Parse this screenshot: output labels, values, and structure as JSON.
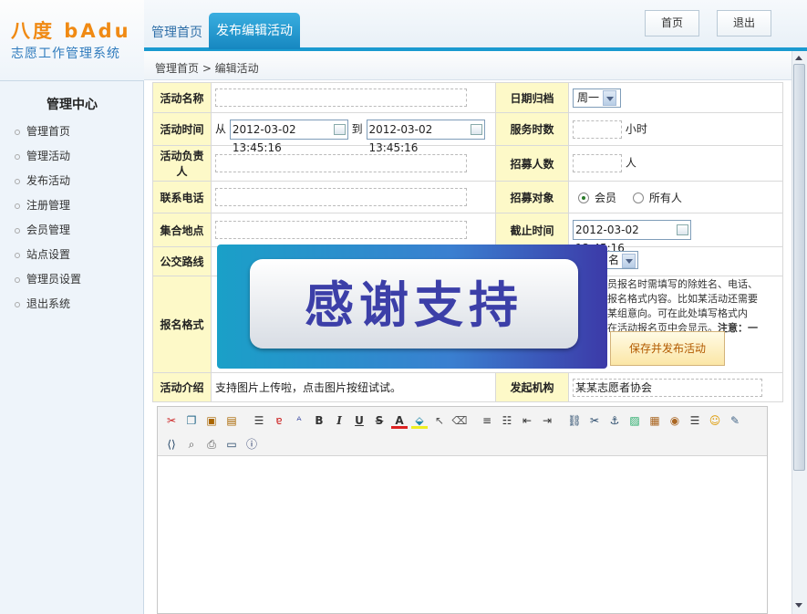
{
  "brand": {
    "title": "八度 bAdu",
    "subtitle": "志愿工作管理系统"
  },
  "nav": {
    "home_tab": "管理首页",
    "active_tab": "发布编辑活动"
  },
  "header_buttons": {
    "home": "首页",
    "exit": "退出"
  },
  "breadcrumb": "管理首页 > 编辑活动",
  "sidebar": {
    "title": "管理中心",
    "items": [
      {
        "label": "管理首页"
      },
      {
        "label": "管理活动"
      },
      {
        "label": "发布活动"
      },
      {
        "label": "注册管理"
      },
      {
        "label": "会员管理"
      },
      {
        "label": "站点设置"
      },
      {
        "label": "管理员设置"
      },
      {
        "label": "退出系统"
      }
    ]
  },
  "form": {
    "activity_name": {
      "label": "活动名称",
      "value": ""
    },
    "date_category": {
      "label": "日期归档",
      "selected": "周一"
    },
    "activity_time": {
      "label": "活动时间",
      "from_text": "从",
      "to_text": "到",
      "start": "2012-03-02 13:45:16",
      "end": "2012-03-02 13:45:16"
    },
    "service_hours": {
      "label": "服务时数",
      "value": "",
      "unit": "小时"
    },
    "leader": {
      "label": "活动负责人",
      "value": ""
    },
    "recruit_count": {
      "label": "招募人数",
      "value": "",
      "unit": "人"
    },
    "phone": {
      "label": "联系电话",
      "value": ""
    },
    "recruit_target": {
      "label": "招募对象",
      "options": [
        "会员",
        "所有人"
      ],
      "selected": "会员"
    },
    "meeting_place": {
      "label": "集合地点",
      "value": ""
    },
    "deadline": {
      "label": "截止时间",
      "value": "2012-03-02 13:45:16"
    },
    "bus_route": {
      "label": "公交路线",
      "select_fragment": "名"
    },
    "signup_format": {
      "label": "报名格式",
      "help_fragment_1": "员报名时需填写的除姓名、电话、",
      "help_fragment_2": "报名格式内容。比如某活动还需要",
      "help_fragment_3": "某组意向。可在此处填写格式内",
      "help_fragment_4": "在活动报名页中会显示。",
      "help_note": "注意：一",
      "publish_button": "保存并发布活动"
    },
    "intro": {
      "label": "活动介绍",
      "hint": "支持图片上传啦，点击图片按纽试试。"
    },
    "organizer": {
      "label": "发起机构",
      "value": "某某志愿者协会"
    }
  },
  "overlay_banner": {
    "text": "感谢支持"
  },
  "editor_toolbar": {
    "icons": [
      "cut-icon",
      "copy-icon",
      "paste-icon",
      "paste-text-icon",
      "paste-word-icon",
      "spellcheck-icon",
      "font-size-icon",
      "bold-icon",
      "italic-icon",
      "underline-icon",
      "strikethrough-icon",
      "font-color-icon",
      "highlight-icon",
      "select-icon",
      "eraser-icon",
      "ordered-list-icon",
      "unordered-list-icon",
      "outdent-icon",
      "indent-icon",
      "link-icon",
      "unlink-icon",
      "anchor-icon",
      "image-icon",
      "flash-icon",
      "media-icon",
      "hr-icon",
      "emoticon-icon",
      "edit-icon",
      "source-code-icon",
      "preview-icon",
      "print-icon",
      "fullscreen-icon",
      "about-icon"
    ],
    "glyphs": {
      "bold": "B",
      "italic": "I",
      "underline": "U",
      "strike": "S",
      "fontcolor": "A"
    }
  }
}
